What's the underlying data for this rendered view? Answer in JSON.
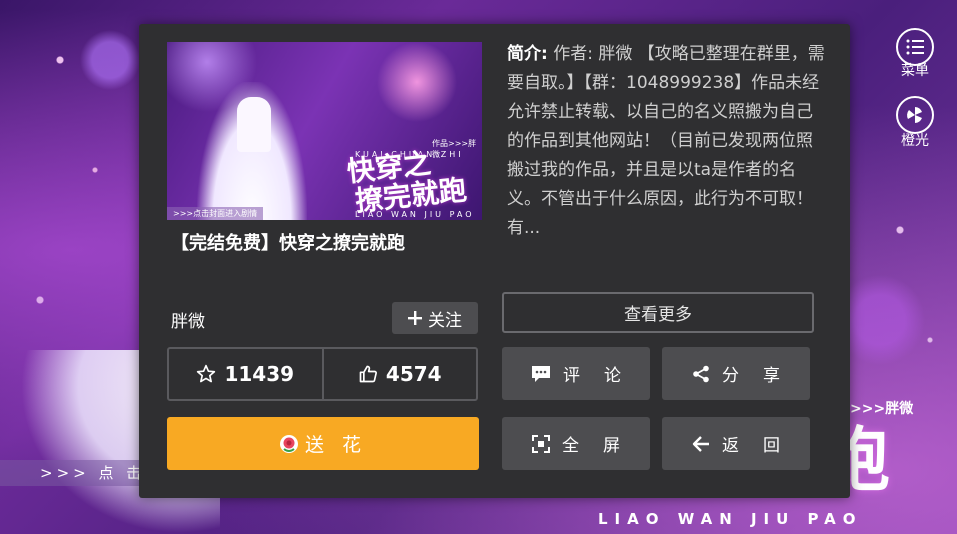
{
  "background": {
    "strip_text": ">>> 点 击",
    "title_fragment": "跑",
    "author_small": ">>>胖微",
    "pinyin": "LIAO WAN JIU PAO"
  },
  "side": {
    "menu_label": "菜单",
    "theme_label": "橙光"
  },
  "panel": {
    "cover": {
      "title_line1": "快穿之",
      "title_line2": "撩完就跑",
      "pinyin_top": "KUAI CHUAN ZHI",
      "pinyin_bottom": "LIAO WAN JIU PAO",
      "author_tag": "作品>>>胖微",
      "strip_text": ">>>点击封面进入剧情"
    },
    "book_title": "【完结免费】快穿之撩完就跑",
    "description_label": "简介:",
    "description": "作者: 胖微 【攻略已整理在群里，需要自取。】【群：1048999238】作品未经允许禁止转载、以自己的名义照搬为自己的作品到其他网站！（目前已发现两位照搬过我的作品，并且是以ta是作者的名义。不管出于什么原因，此行为不可取！有...",
    "author_name": "胖微",
    "follow_label": "关注",
    "favorites_count": "11439",
    "likes_count": "4574",
    "flower_label": "送 花",
    "more_label": "查看更多",
    "comment_label": "评论",
    "share_label": "分享",
    "fullscreen_label": "全屏",
    "back_label": "返回"
  },
  "colors": {
    "panel_bg": "#2f2f31",
    "button_gray": "#4d4d50",
    "flower_orange": "#f8a923"
  },
  "icons": [
    "menu-icon",
    "theme-icon",
    "plus-icon",
    "star-icon",
    "thumb-icon",
    "flower-icon",
    "comment-icon",
    "share-icon",
    "fullscreen-icon",
    "back-arrow-icon"
  ]
}
